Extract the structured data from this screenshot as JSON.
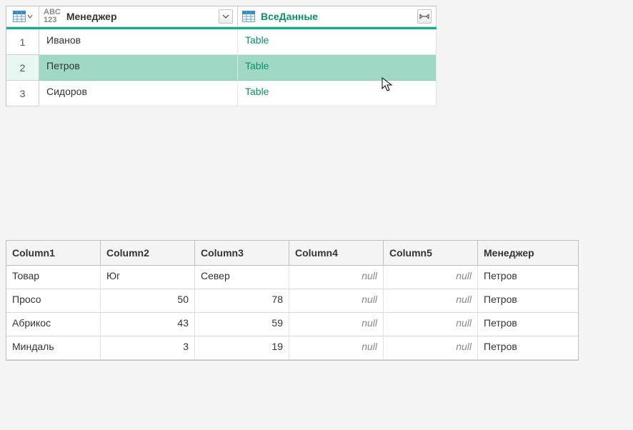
{
  "topgrid": {
    "columns": [
      {
        "label": "Менеджер",
        "kind": "text"
      },
      {
        "label": "ВсеДанные",
        "kind": "table"
      }
    ],
    "rows": [
      {
        "num": "1",
        "manager": "Иванов",
        "data": "Table",
        "selected": false
      },
      {
        "num": "2",
        "manager": "Петров",
        "data": "Table",
        "selected": true
      },
      {
        "num": "3",
        "manager": "Сидоров",
        "data": "Table",
        "selected": false
      }
    ],
    "null_text": "null"
  },
  "preview": {
    "headers": [
      "Column1",
      "Column2",
      "Column3",
      "Column4",
      "Column5",
      "Менеджер"
    ],
    "rows": [
      {
        "c1": "Товар",
        "c2": "Юг",
        "c2_num": false,
        "c3": "Север",
        "c3_num": false,
        "c4": null,
        "c5": null,
        "c6": "Петров"
      },
      {
        "c1": "Просо",
        "c2": "50",
        "c2_num": true,
        "c3": "78",
        "c3_num": true,
        "c4": null,
        "c5": null,
        "c6": "Петров"
      },
      {
        "c1": "Абрикос",
        "c2": "43",
        "c2_num": true,
        "c3": "59",
        "c3_num": true,
        "c4": null,
        "c5": null,
        "c6": "Петров"
      },
      {
        "c1": "Миндаль",
        "c2": "3",
        "c2_num": true,
        "c3": "19",
        "c3_num": true,
        "c4": null,
        "c5": null,
        "c6": "Петров"
      }
    ]
  }
}
